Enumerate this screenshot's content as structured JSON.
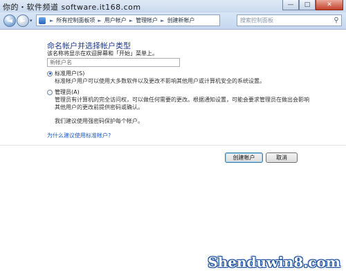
{
  "chrome": {
    "site_watermark": "你的・软件频道 software.it168.com",
    "minimize": "—",
    "maximize": "□",
    "close": "✕"
  },
  "navbar": {
    "back": "◄",
    "forward": "►",
    "dropdown": "▾",
    "breadcrumbs": [
      "所有控制面板项",
      "用户帐户",
      "管理帐户",
      "创建新帐户"
    ],
    "separator": "►",
    "refresh": "↻",
    "search_placeholder": "搜索控制面板",
    "search_icon": "⚲"
  },
  "content": {
    "heading": "命名帐户并选择帐户类型",
    "subtext": "该名称将显示在欢迎屏幕和「开始」菜单上。",
    "name_input_value": "新帐户名",
    "standard": {
      "label": "标准用户(S)",
      "checked": true,
      "description": "标准帐户用户可以使用大多数软件以及更改不影响其他用户或计算机安全的系统设置。"
    },
    "admin": {
      "label": "管理员(A)",
      "checked": false,
      "description_line1": "管理员有计算机的完全访问权，可以做任何需要的更改。根据通知设置，可能会要求管理员在做出会影响",
      "description_line2": "其他用户的更改前提供密码或确认。",
      "recommend": "我们建议使用强密码保护每个帐户。"
    },
    "help_link": "为什么建议使用标准帐户?",
    "create_button": "创建帐户",
    "cancel_button": "取消"
  },
  "watermark": "Shenduwin8.com"
}
